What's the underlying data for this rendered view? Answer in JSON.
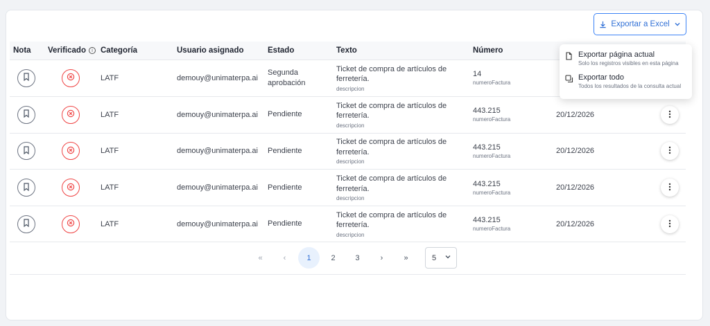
{
  "export": {
    "label": "Exportar a Excel"
  },
  "dropdown": {
    "items": [
      {
        "title": "Exportar página actual",
        "subtitle": "Solo los registros visibles en esta página"
      },
      {
        "title": "Exportar todo",
        "subtitle": "Todos los resultados de la consulta actual"
      }
    ]
  },
  "table": {
    "headers": [
      "Nota",
      "Verificado",
      "Categoría",
      "Usuario asignado",
      "Estado",
      "Texto",
      "Número"
    ],
    "text_sublabel": "descripcion",
    "number_sublabel": "numeroFactura",
    "rows": [
      {
        "categoria": "LATF",
        "usuario": "demouy@unimaterpa.ai",
        "estado": "Segunda aprobación",
        "texto": "Ticket de compra de artículos de ferretería.",
        "numero": "14",
        "fecha": ""
      },
      {
        "categoria": "LATF",
        "usuario": "demouy@unimaterpa.ai",
        "estado": "Pendiente",
        "texto": "Ticket de compra de artículos de ferretería.",
        "numero": "443.215",
        "fecha": "20/12/2026"
      },
      {
        "categoria": "LATF",
        "usuario": "demouy@unimaterpa.ai",
        "estado": "Pendiente",
        "texto": "Ticket de compra de artículos de ferretería.",
        "numero": "443.215",
        "fecha": "20/12/2026"
      },
      {
        "categoria": "LATF",
        "usuario": "demouy@unimaterpa.ai",
        "estado": "Pendiente",
        "texto": "Ticket de compra de artículos de ferretería.",
        "numero": "443.215",
        "fecha": "20/12/2026"
      },
      {
        "categoria": "LATF",
        "usuario": "demouy@unimaterpa.ai",
        "estado": "Pendiente",
        "texto": "Ticket de compra de artículos de ferretería.",
        "numero": "443.215",
        "fecha": "20/12/2026"
      }
    ]
  },
  "pagination": {
    "first": "«",
    "prev": "‹",
    "pages": [
      "1",
      "2",
      "3"
    ],
    "current": "1",
    "next": "›",
    "last": "»",
    "page_size": "5"
  },
  "colors": {
    "accent": "#2f6fd6",
    "danger": "#ef4444"
  }
}
